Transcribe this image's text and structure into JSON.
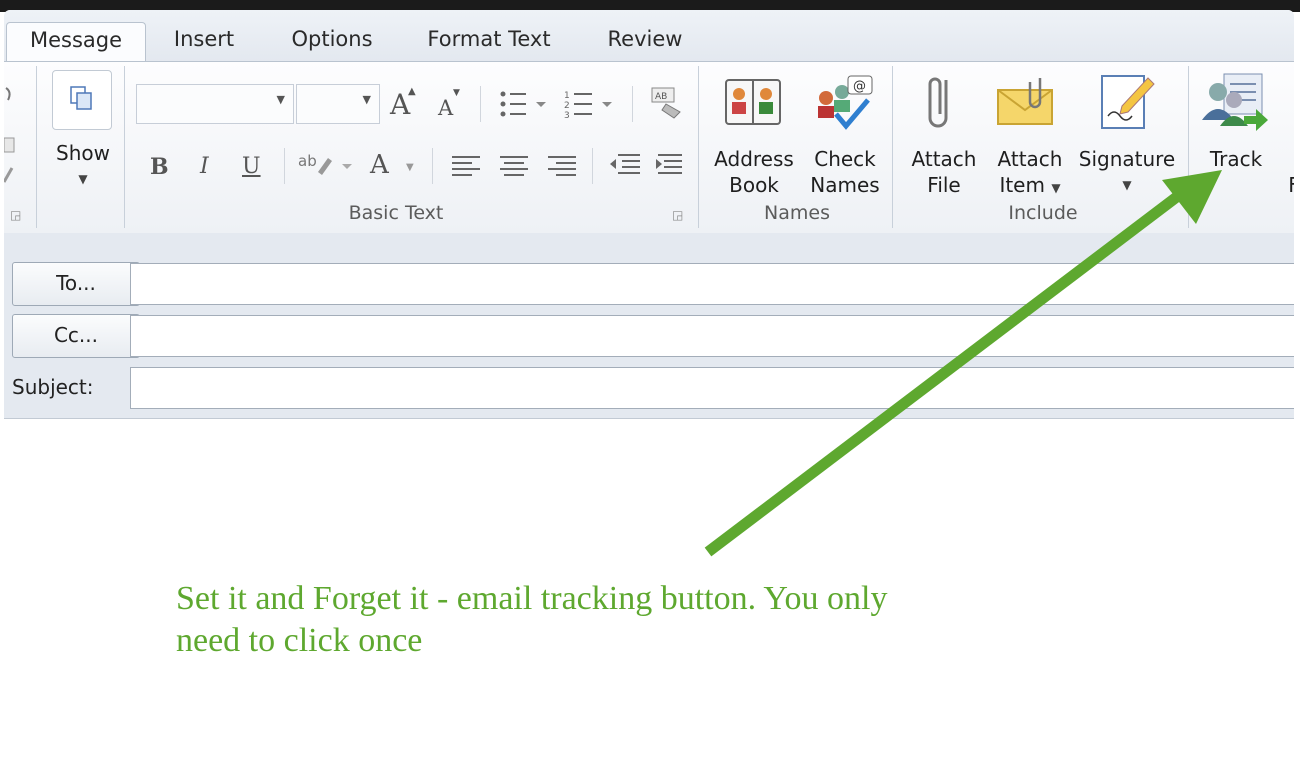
{
  "tabs": [
    {
      "label": "Message",
      "active": true
    },
    {
      "label": "Insert"
    },
    {
      "label": "Options"
    },
    {
      "label": "Format Text"
    },
    {
      "label": "Review"
    }
  ],
  "ribbon": {
    "show": {
      "label": "Show"
    },
    "basic_text": {
      "group_label": "Basic Text",
      "bold": "B",
      "italic": "I",
      "underline": "U",
      "grow_font": "A",
      "shrink_font": "A",
      "font_color": "A"
    },
    "names": {
      "group_label": "Names",
      "address_book": {
        "line1": "Address",
        "line2": "Book"
      },
      "check_names": {
        "line1": "Check",
        "line2": "Names"
      }
    },
    "include": {
      "group_label": "Include",
      "attach_file": {
        "line1": "Attach",
        "line2": "File"
      },
      "attach_item": {
        "line1": "Attach",
        "line2": "Item"
      },
      "signature": {
        "line1": "Signature"
      }
    },
    "track": {
      "label": "Track"
    },
    "partial_label": "F"
  },
  "header": {
    "to_label": "To...",
    "cc_label": "Cc...",
    "subject_label": "Subject:"
  },
  "annotation": {
    "text": "Set it and Forget it - email tracking button. You only need to click once",
    "color": "#5ea82f"
  },
  "colors": {
    "arrow": "#5ea82f",
    "ribbon_border": "#b9c3cf"
  }
}
